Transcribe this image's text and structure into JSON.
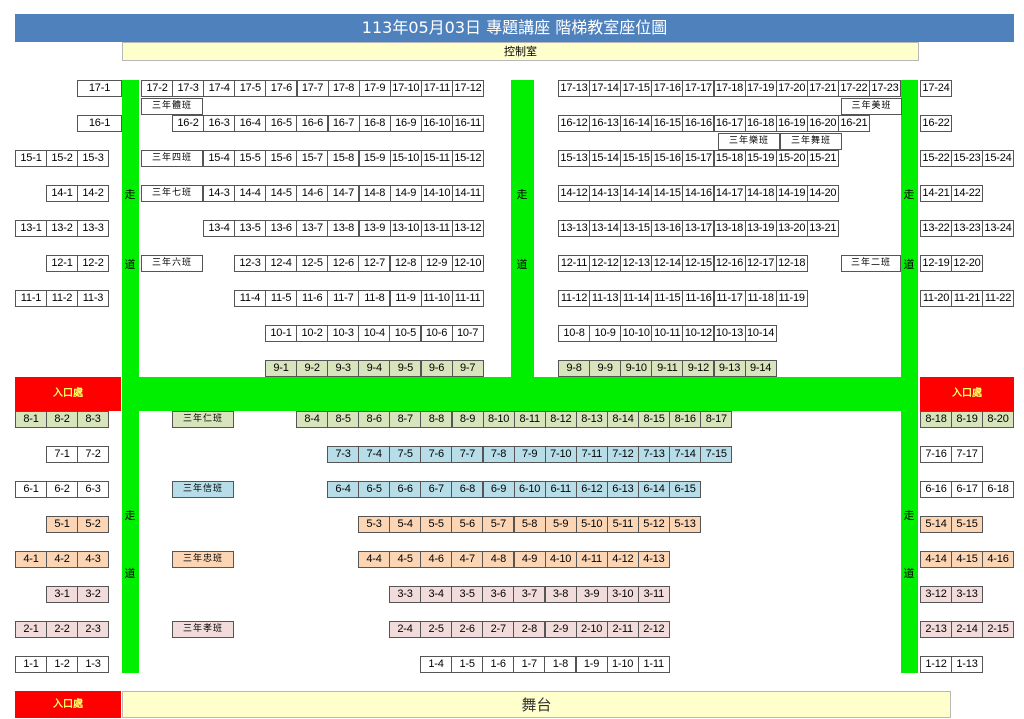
{
  "header": {
    "title": "113年05月03日 專題講座 階梯教室座位圖"
  },
  "control_room": {
    "label": "控制室"
  },
  "stage": {
    "label": "舞台"
  },
  "entrance": {
    "label": "入口處"
  },
  "aisle": {
    "char1": "走",
    "char2": "道"
  },
  "colors": {
    "white": "#ffffff",
    "green": "#d8e4bc",
    "blue": "#b7dee8",
    "orange": "#fcd5b4",
    "pink": "#f2dcdb",
    "aisle": "#00ee00",
    "title": "#4f81bd",
    "entrance": "#ff0000",
    "banner": "#ffffcc"
  },
  "rows": {
    "r17": [
      "17-1",
      "17-2",
      "17-3",
      "17-4",
      "17-5",
      "17-6",
      "17-7",
      "17-8",
      "17-9",
      "17-10",
      "17-11",
      "17-12",
      "17-13",
      "17-14",
      "17-15",
      "17-16",
      "17-17",
      "17-18",
      "17-19",
      "17-20",
      "17-21",
      "17-22",
      "17-23",
      "17-24"
    ],
    "r16": [
      "16-1",
      "16-2",
      "16-3",
      "16-4",
      "16-5",
      "16-6",
      "16-7",
      "16-8",
      "16-9",
      "16-10",
      "16-11",
      "16-12",
      "16-13",
      "16-14",
      "16-15",
      "16-16",
      "16-17",
      "16-18",
      "16-19",
      "16-20",
      "16-21",
      "16-22"
    ],
    "r15": [
      "15-1",
      "15-2",
      "15-3",
      "15-4",
      "15-5",
      "15-6",
      "15-7",
      "15-8",
      "15-9",
      "15-10",
      "15-11",
      "15-12",
      "15-13",
      "15-14",
      "15-15",
      "15-16",
      "15-17",
      "15-18",
      "15-19",
      "15-20",
      "15-21",
      "15-22",
      "15-23",
      "15-24"
    ],
    "r14": [
      "14-1",
      "14-2",
      "14-3",
      "14-4",
      "14-5",
      "14-6",
      "14-7",
      "14-8",
      "14-9",
      "14-10",
      "14-11",
      "14-12",
      "14-13",
      "14-14",
      "14-15",
      "14-16",
      "14-17",
      "14-18",
      "14-19",
      "14-20",
      "14-21",
      "14-22"
    ],
    "r13": [
      "13-1",
      "13-2",
      "13-3",
      "13-4",
      "13-5",
      "13-6",
      "13-7",
      "13-8",
      "13-9",
      "13-10",
      "13-11",
      "13-12",
      "13-13",
      "13-14",
      "13-15",
      "13-16",
      "13-17",
      "13-18",
      "13-19",
      "13-20",
      "13-21",
      "13-22",
      "13-23",
      "13-24"
    ],
    "r12": [
      "12-1",
      "12-2",
      "12-3",
      "12-4",
      "12-5",
      "12-6",
      "12-7",
      "12-8",
      "12-9",
      "12-10",
      "12-11",
      "12-12",
      "12-13",
      "12-14",
      "12-15",
      "12-16",
      "12-17",
      "12-18",
      "12-19",
      "12-20"
    ],
    "r11": [
      "11-1",
      "11-2",
      "11-3",
      "11-4",
      "11-5",
      "11-6",
      "11-7",
      "11-8",
      "11-9",
      "11-10",
      "11-11",
      "11-12",
      "11-13",
      "11-14",
      "11-15",
      "11-16",
      "11-17",
      "11-18",
      "11-19",
      "11-20",
      "11-21",
      "11-22"
    ],
    "r10": [
      "10-1",
      "10-2",
      "10-3",
      "10-4",
      "10-5",
      "10-6",
      "10-7",
      "10-8",
      "10-9",
      "10-10",
      "10-11",
      "10-12",
      "10-13",
      "10-14"
    ],
    "r9": [
      "9-1",
      "9-2",
      "9-3",
      "9-4",
      "9-5",
      "9-6",
      "9-7",
      "9-8",
      "9-9",
      "9-10",
      "9-11",
      "9-12",
      "9-13",
      "9-14"
    ],
    "r8": [
      "8-1",
      "8-2",
      "8-3",
      "8-4",
      "8-5",
      "8-6",
      "8-7",
      "8-8",
      "8-9",
      "8-10",
      "8-11",
      "8-12",
      "8-13",
      "8-14",
      "8-15",
      "8-16",
      "8-17",
      "8-18",
      "8-19",
      "8-20"
    ],
    "r7": [
      "7-1",
      "7-2",
      "7-3",
      "7-4",
      "7-5",
      "7-6",
      "7-7",
      "7-8",
      "7-9",
      "7-10",
      "7-11",
      "7-12",
      "7-13",
      "7-14",
      "7-15",
      "7-16",
      "7-17"
    ],
    "r6": [
      "6-1",
      "6-2",
      "6-3",
      "6-4",
      "6-5",
      "6-6",
      "6-7",
      "6-8",
      "6-9",
      "6-10",
      "6-11",
      "6-12",
      "6-13",
      "6-14",
      "6-15",
      "6-16",
      "6-17",
      "6-18"
    ],
    "r5": [
      "5-1",
      "5-2",
      "5-3",
      "5-4",
      "5-5",
      "5-6",
      "5-7",
      "5-8",
      "5-9",
      "5-10",
      "5-11",
      "5-12",
      "5-13",
      "5-14",
      "5-15"
    ],
    "r4": [
      "4-1",
      "4-2",
      "4-3",
      "4-4",
      "4-5",
      "4-6",
      "4-7",
      "4-8",
      "4-9",
      "4-10",
      "4-11",
      "4-12",
      "4-13",
      "4-14",
      "4-15",
      "4-16"
    ],
    "r3": [
      "3-1",
      "3-2",
      "3-3",
      "3-4",
      "3-5",
      "3-6",
      "3-7",
      "3-8",
      "3-9",
      "3-10",
      "3-11",
      "3-12",
      "3-13"
    ],
    "r2": [
      "2-1",
      "2-2",
      "2-3",
      "2-4",
      "2-5",
      "2-6",
      "2-7",
      "2-8",
      "2-9",
      "2-10",
      "2-11",
      "2-12",
      "2-13",
      "2-14",
      "2-15"
    ],
    "r1": [
      "1-1",
      "1-2",
      "1-3",
      "1-4",
      "1-5",
      "1-6",
      "1-7",
      "1-8",
      "1-9",
      "1-10",
      "1-11",
      "1-12",
      "1-13"
    ]
  },
  "class_labels": {
    "c_ti": "三年體班",
    "c_mei": "三年美班",
    "c_yue": "三年樂班",
    "c_wu": "三年舞班",
    "c_si": "三年四班",
    "c_qi": "三年七班",
    "c_liu": "三年六班",
    "c_er": "三年二班",
    "c_ren": "三年仁班",
    "c_xin": "三年信班",
    "c_zhong": "三年忠班",
    "c_xiao": "三年孝班"
  }
}
